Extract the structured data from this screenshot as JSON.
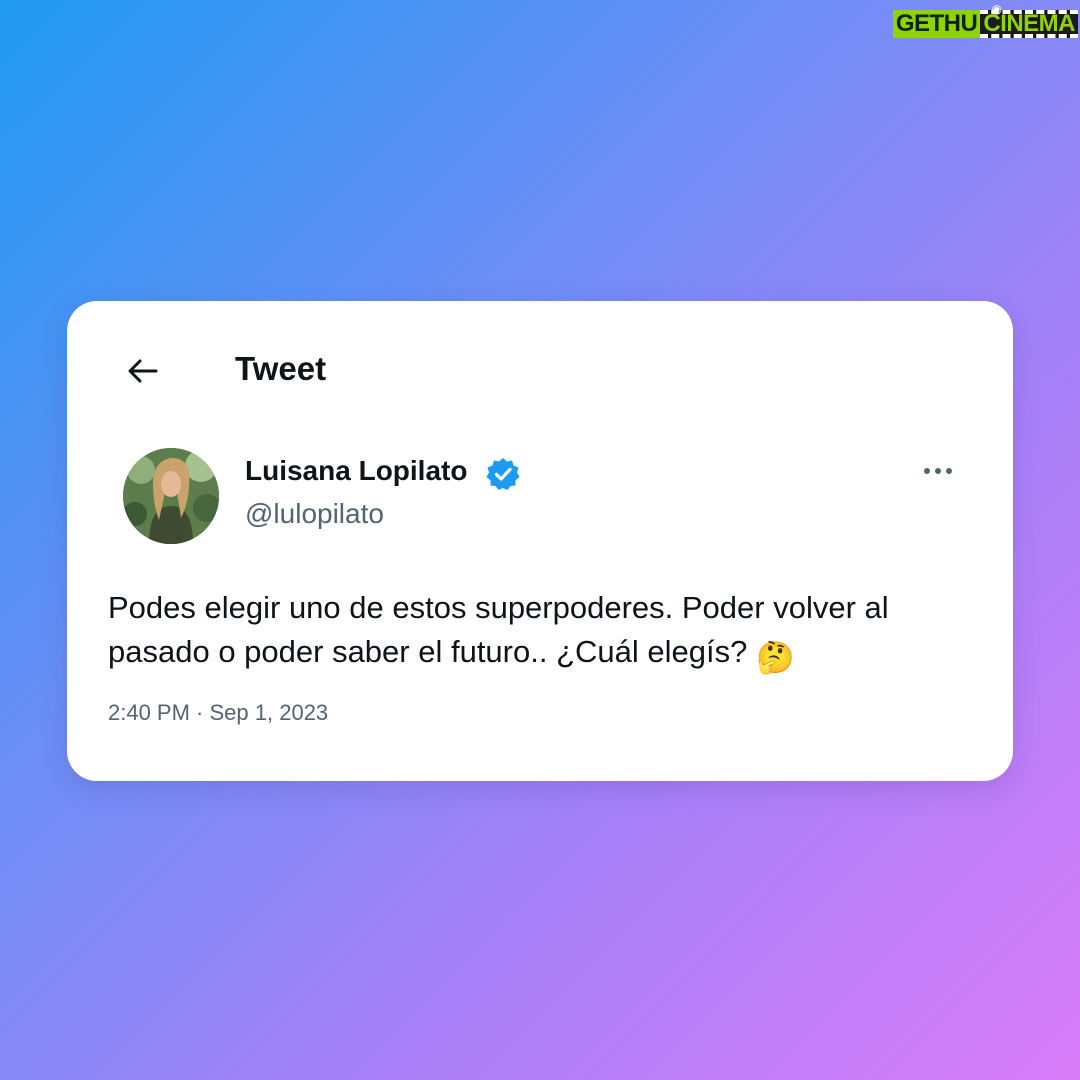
{
  "watermark": {
    "part_a": "GETHU",
    "part_b": "CINEMA"
  },
  "header": {
    "title": "Tweet",
    "back_icon": "arrow-left-icon"
  },
  "author": {
    "name": "Luisana Lopilato",
    "handle": "@lulopilato",
    "verified": true,
    "verified_icon": "verified-badge-icon",
    "more_icon": "more-horizontal-icon"
  },
  "tweet": {
    "text": "Podes elegir uno de estos superpoderes. Poder volver al pasado o poder saber el futuro.. ¿Cuál elegís?",
    "emoji": "🤔",
    "time": "2:40 PM",
    "separator": " · ",
    "date": "Sep 1, 2023"
  },
  "colors": {
    "accent": "#1d9bf0",
    "text_primary": "#0f1419",
    "text_secondary": "#536471",
    "gradient_start": "#1f9af2",
    "gradient_end": "#d97cf8"
  }
}
